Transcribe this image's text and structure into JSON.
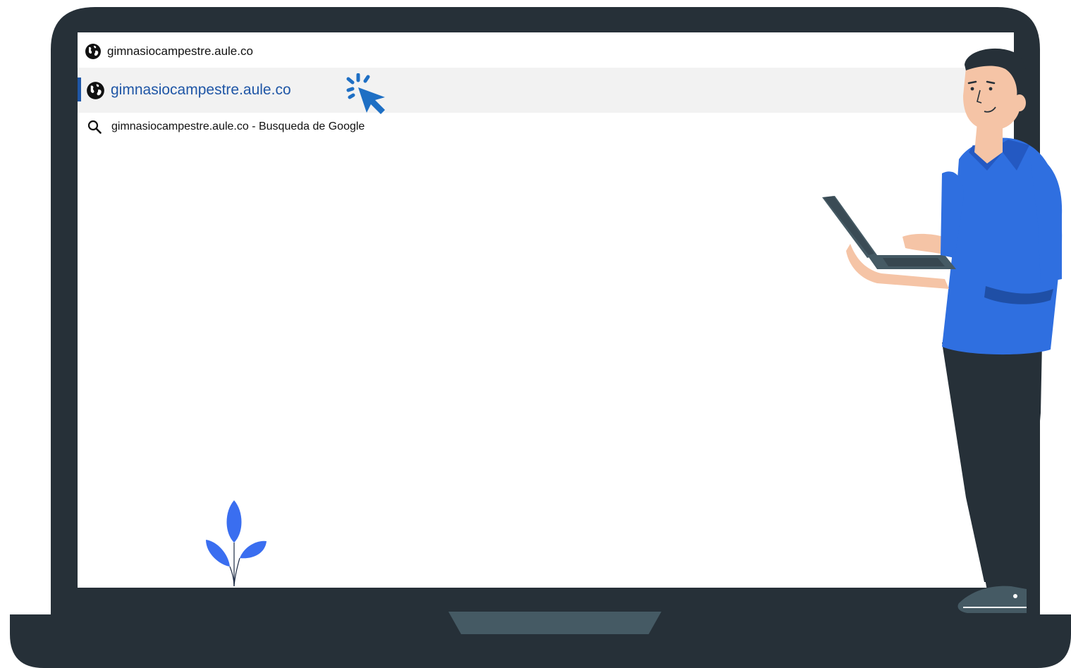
{
  "omnibox": {
    "suggestion_top": {
      "text": "gimnasiocampestre.aule.co",
      "icon": "globe-icon"
    },
    "suggestion_selected": {
      "text": "gimnasiocampestre.aule.co",
      "icon": "globe-icon"
    },
    "suggestion_search": {
      "text": "gimnasiocampestre.aule.co - Busqueda de Google",
      "icon": "search-icon"
    }
  },
  "colors": {
    "laptop_frame": "#263038",
    "trackpad": "#455a64",
    "highlight_row": "#f2f2f2",
    "link_blue": "#1f56a6",
    "cursor_blue": "#1e6fc4",
    "shirt_blue": "#2f6fe0",
    "plant_blue": "#3a6ef0"
  }
}
